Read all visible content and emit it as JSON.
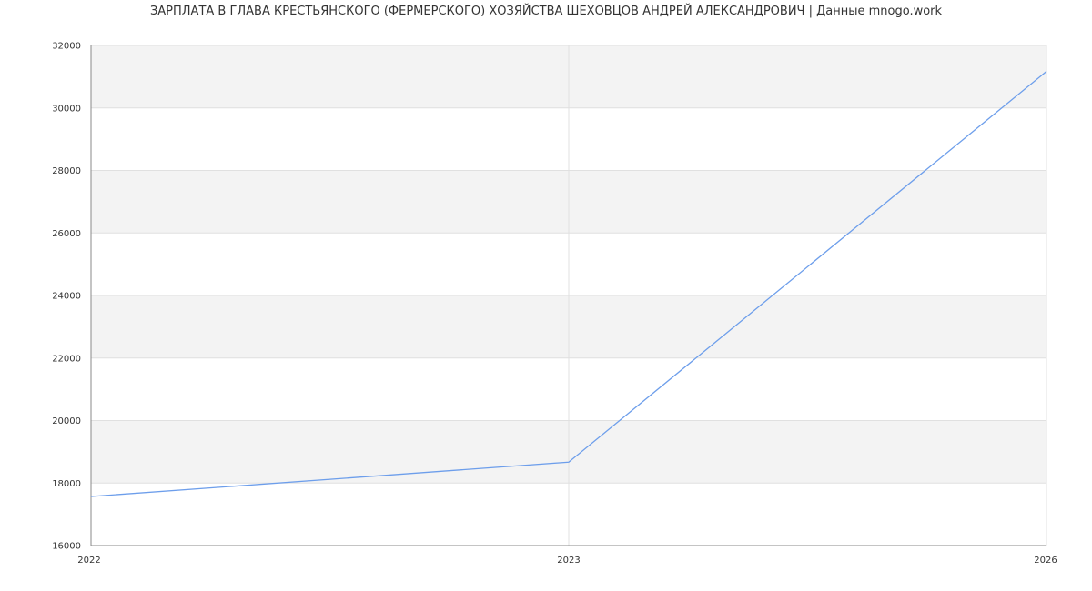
{
  "chart_data": {
    "type": "line",
    "title": "ЗАРПЛАТА В ГЛАВА КРЕСТЬЯНСКОГО (ФЕРМЕРСКОГО) ХОЗЯЙСТВА ШЕХОВЦОВ АНДРЕЙ АЛЕКСАНДРОВИЧ | Данные mnogo.work",
    "categories": [
      "2022",
      "2023",
      "2026"
    ],
    "series": [
      {
        "values": [
          17570,
          18670,
          31170
        ],
        "color": "#6d9eeb"
      }
    ],
    "ylim": [
      16000,
      32000
    ],
    "yticks": [
      16000,
      18000,
      20000,
      22000,
      24000,
      26000,
      28000,
      30000,
      32000
    ],
    "grid": true,
    "band_color": "#f3f3f3",
    "grid_color": "#e0e0e0",
    "axis_color": "#888888"
  }
}
